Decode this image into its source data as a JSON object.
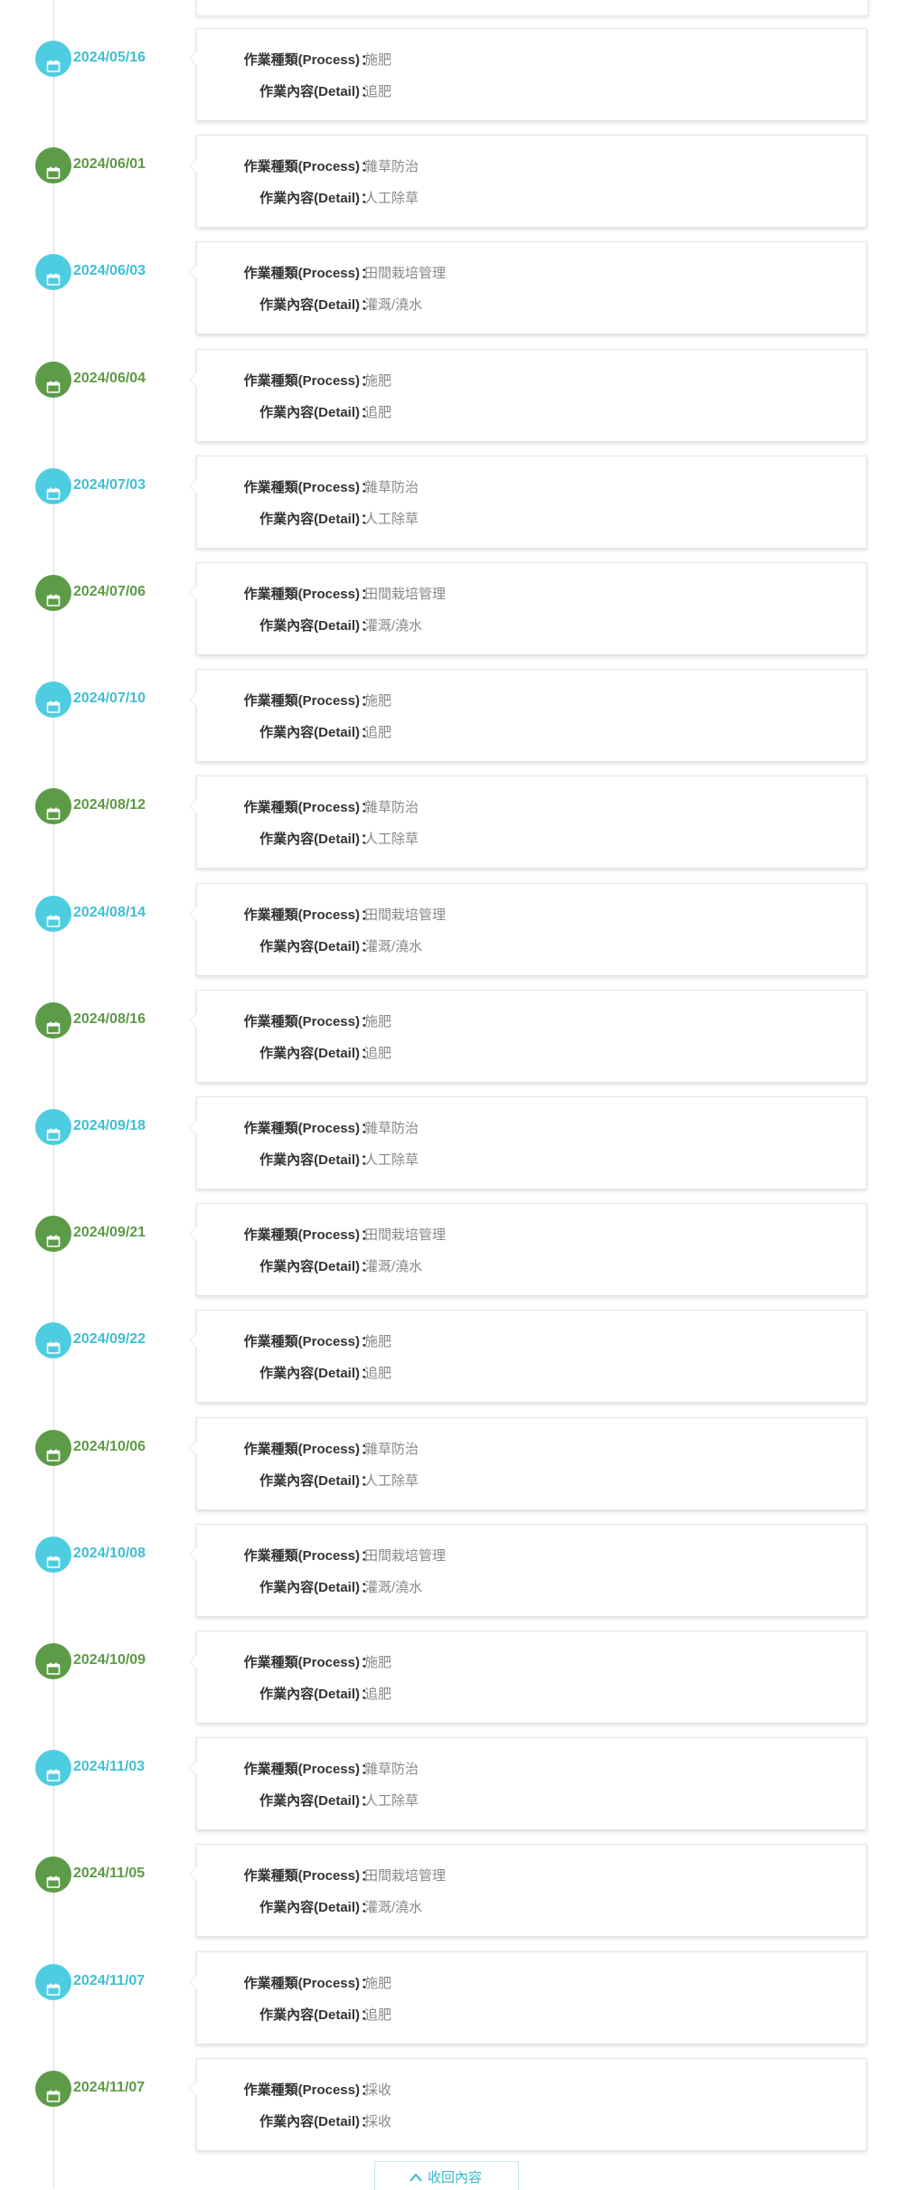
{
  "labels": {
    "process": "作業種類(Process)",
    "detail": "作業內容(Detail)",
    "colon": "："
  },
  "colors": {
    "teal": "#4fcde0",
    "green": "#5d9b48",
    "teal_text": "#3fbfd1",
    "green_text": "#5c9a45"
  },
  "icons": {
    "marker": "calendar-icon",
    "collapse": "chevron-up-icon"
  },
  "records": [
    {
      "date": "2024/05/16",
      "process": "施肥",
      "detail": "追肥",
      "color": "teal"
    },
    {
      "date": "2024/06/01",
      "process": "雜草防治",
      "detail": "人工除草",
      "color": "green"
    },
    {
      "date": "2024/06/03",
      "process": "田間栽培管理",
      "detail": "灌溉/澆水",
      "color": "teal"
    },
    {
      "date": "2024/06/04",
      "process": "施肥",
      "detail": "追肥",
      "color": "green"
    },
    {
      "date": "2024/07/03",
      "process": "雜草防治",
      "detail": "人工除草",
      "color": "teal"
    },
    {
      "date": "2024/07/06",
      "process": "田間栽培管理",
      "detail": "灌溉/澆水",
      "color": "green"
    },
    {
      "date": "2024/07/10",
      "process": "施肥",
      "detail": "追肥",
      "color": "teal"
    },
    {
      "date": "2024/08/12",
      "process": "雜草防治",
      "detail": "人工除草",
      "color": "green"
    },
    {
      "date": "2024/08/14",
      "process": "田間栽培管理",
      "detail": "灌溉/澆水",
      "color": "teal"
    },
    {
      "date": "2024/08/16",
      "process": "施肥",
      "detail": "追肥",
      "color": "green"
    },
    {
      "date": "2024/09/18",
      "process": "雜草防治",
      "detail": "人工除草",
      "color": "teal"
    },
    {
      "date": "2024/09/21",
      "process": "田間栽培管理",
      "detail": "灌溉/澆水",
      "color": "green"
    },
    {
      "date": "2024/09/22",
      "process": "施肥",
      "detail": "追肥",
      "color": "teal"
    },
    {
      "date": "2024/10/06",
      "process": "雜草防治",
      "detail": "人工除草",
      "color": "green"
    },
    {
      "date": "2024/10/08",
      "process": "田間栽培管理",
      "detail": "灌溉/澆水",
      "color": "teal"
    },
    {
      "date": "2024/10/09",
      "process": "施肥",
      "detail": "追肥",
      "color": "green"
    },
    {
      "date": "2024/11/03",
      "process": "雜草防治",
      "detail": "人工除草",
      "color": "teal"
    },
    {
      "date": "2024/11/05",
      "process": "田間栽培管理",
      "detail": "灌溉/澆水",
      "color": "green"
    },
    {
      "date": "2024/11/07",
      "process": "施肥",
      "detail": "追肥",
      "color": "teal"
    },
    {
      "date": "2024/11/07",
      "process": "採收",
      "detail": "採收",
      "color": "green"
    }
  ],
  "collapse_button": {
    "label": "收回內容"
  }
}
